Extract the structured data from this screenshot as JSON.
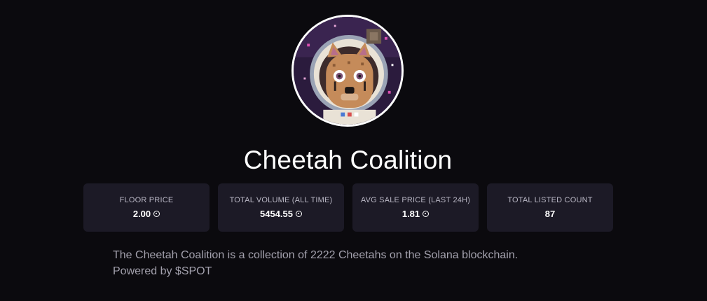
{
  "collection": {
    "name": "Cheetah Coalition",
    "avatar_alt": "cheetah-astronaut-pixel-avatar"
  },
  "stats": [
    {
      "label": "FLOOR PRICE",
      "value": "2.00",
      "currency_icon": "solana-icon"
    },
    {
      "label": "TOTAL VOLUME (ALL TIME)",
      "value": "5454.55",
      "currency_icon": "solana-icon"
    },
    {
      "label": "AVG SALE PRICE (LAST 24H)",
      "value": "1.81",
      "currency_icon": "solana-icon"
    },
    {
      "label": "TOTAL LISTED COUNT",
      "value": "87",
      "currency_icon": ""
    }
  ],
  "description": {
    "line1": "The Cheetah Coalition is a collection of 2222 Cheetahs on the Solana blockchain.",
    "line2": "Powered by $SPOT"
  },
  "colors": {
    "background": "#0b0a0e",
    "card": "#1c1a26",
    "muted_text": "#a3a1ad"
  }
}
